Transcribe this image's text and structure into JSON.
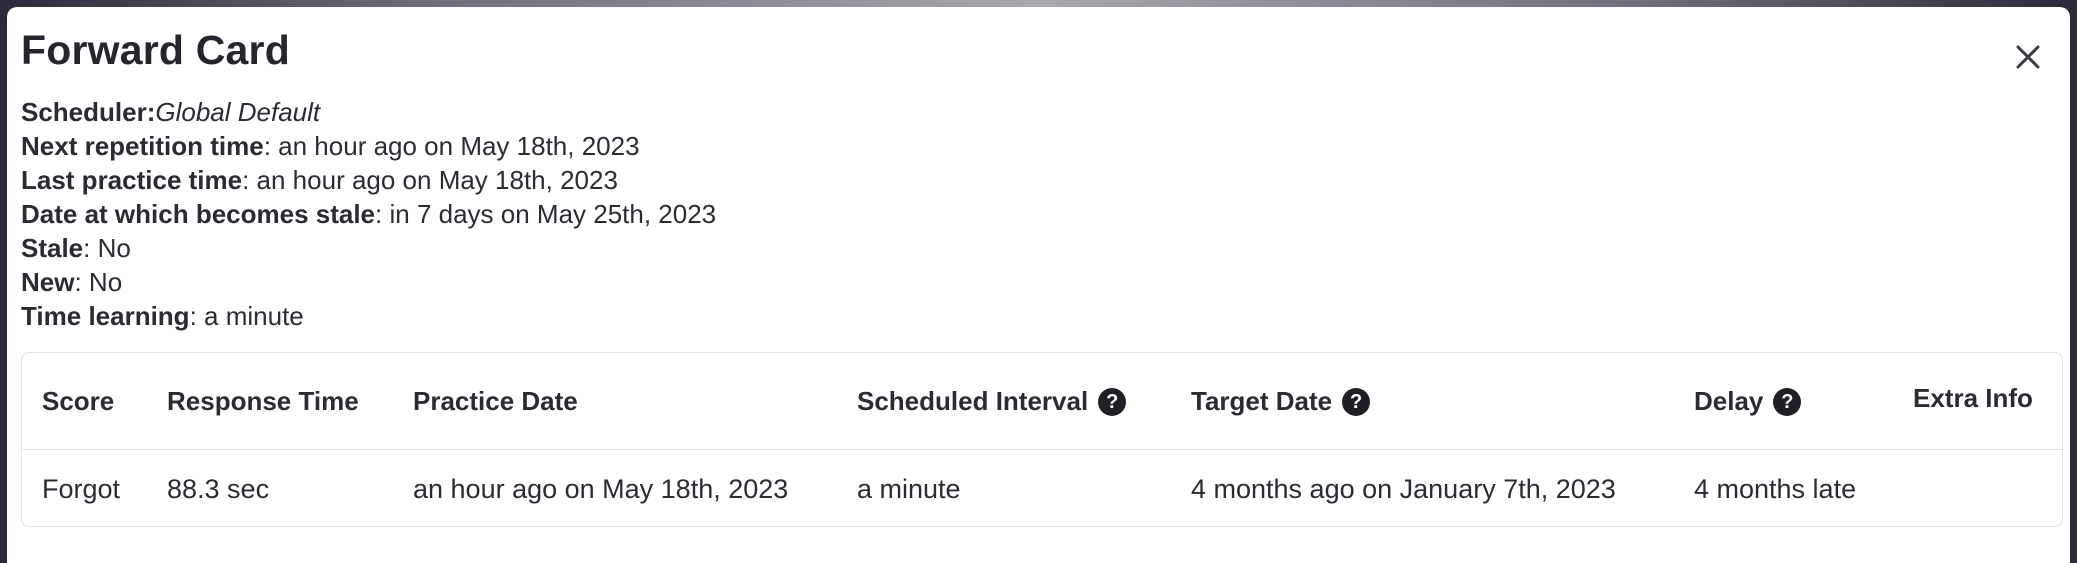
{
  "dialog": {
    "title": "Forward Card",
    "close_icon": "close-icon"
  },
  "info": {
    "scheduler_label": "Scheduler:",
    "scheduler_value": "Global Default",
    "next_rep_label": "Next repetition time",
    "next_rep_value": ": an hour ago on May 18th, 2023",
    "last_practice_label": "Last practice time",
    "last_practice_value": ": an hour ago on May 18th, 2023",
    "stale_date_label": "Date at which becomes stale",
    "stale_date_value": ": in 7 days on May 25th, 2023",
    "stale_label": "Stale",
    "stale_value": ": No",
    "new_label": "New",
    "new_value": ": No",
    "time_learning_label": "Time learning",
    "time_learning_value": ": a minute"
  },
  "table": {
    "headers": {
      "score": "Score",
      "response_time": "Response Time",
      "practice_date": "Practice Date",
      "scheduled_interval": "Scheduled Interval",
      "target_date": "Target Date",
      "delay": "Delay",
      "extra_info": "Extra Info"
    },
    "help_glyph": "?",
    "rows": [
      {
        "score": "Forgot",
        "response_time": "88.3 sec",
        "practice_date": "an hour ago on May 18th, 2023",
        "scheduled_interval": "a minute",
        "target_date": "4 months ago on January 7th, 2023",
        "delay": "4 months late",
        "extra_info": ""
      }
    ]
  }
}
